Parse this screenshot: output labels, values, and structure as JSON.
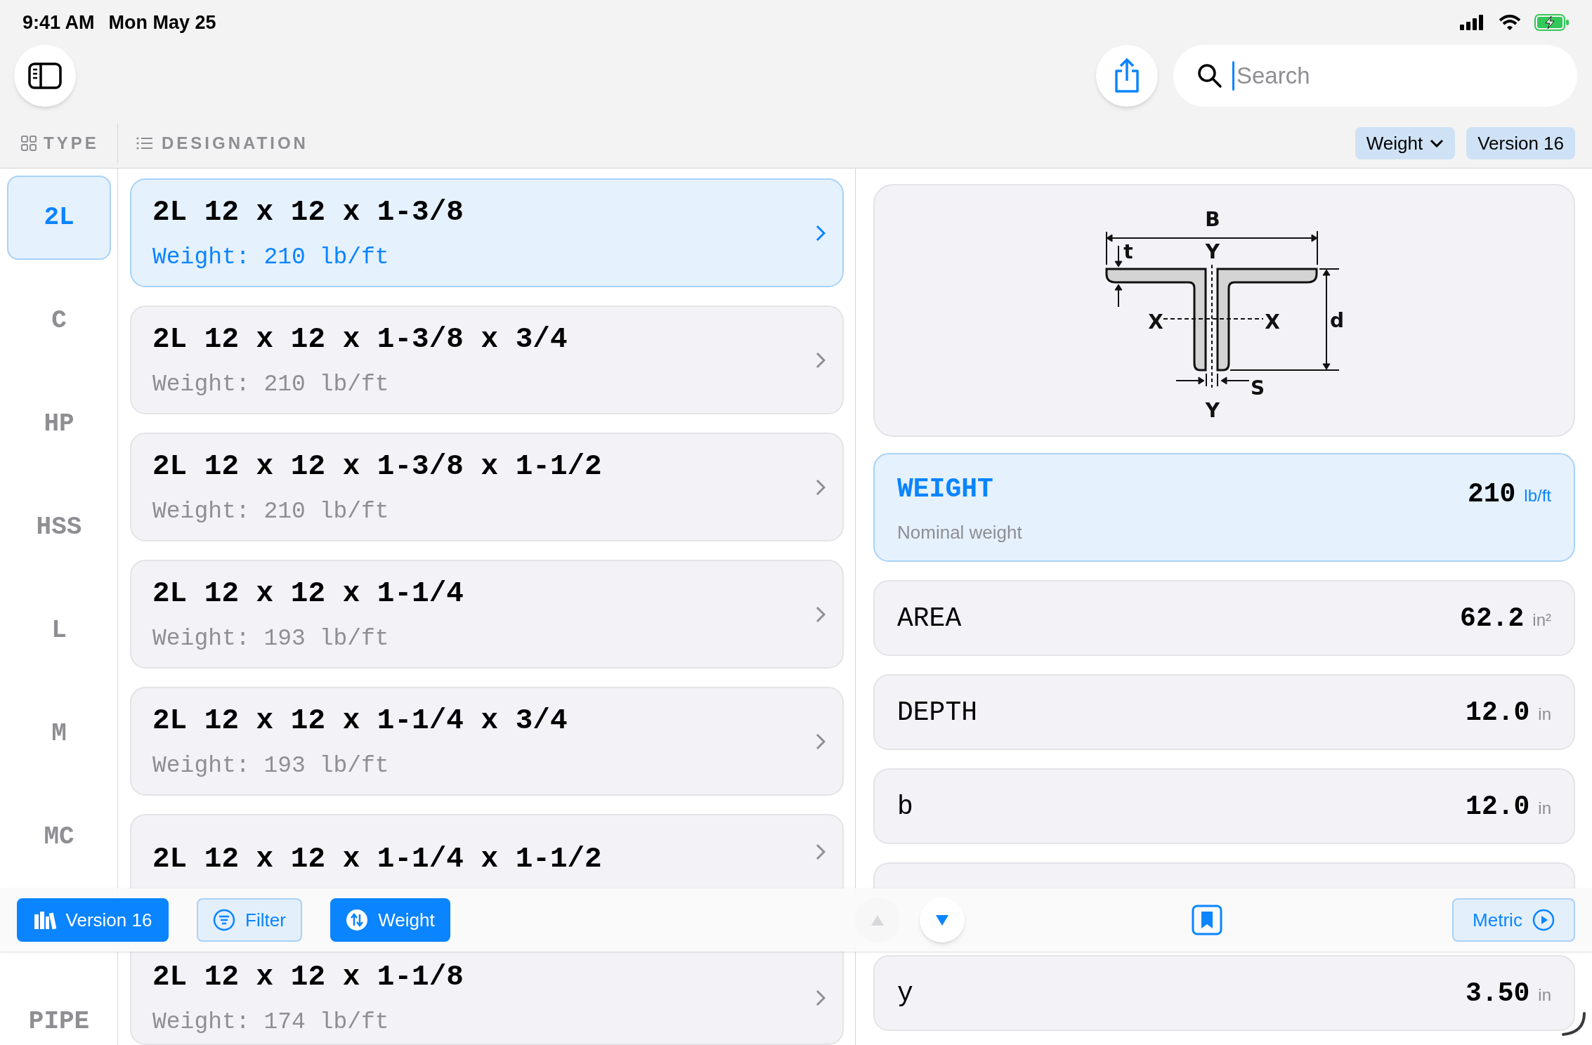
{
  "status_bar": {
    "time": "9:41 AM",
    "date": "Mon May 25"
  },
  "search": {
    "placeholder": "Search"
  },
  "headers": {
    "type": "TYPE",
    "designation": "DESIGNATION"
  },
  "chips": [
    {
      "label": "Weight",
      "kind": "dropdown"
    },
    {
      "label": "Version 16",
      "kind": "plain"
    }
  ],
  "types": [
    {
      "label": "2L",
      "selected": true
    },
    {
      "label": "C",
      "selected": false
    },
    {
      "label": "HP",
      "selected": false
    },
    {
      "label": "HSS",
      "selected": false
    },
    {
      "label": "L",
      "selected": false
    },
    {
      "label": "M",
      "selected": false
    },
    {
      "label": "MC",
      "selected": false
    },
    {
      "label": "PIPE",
      "selected": false
    }
  ],
  "sections": [
    {
      "title": "2L 12 x 12 x 1-3/8",
      "subtitle": "Weight: 210 lb/ft",
      "selected": true
    },
    {
      "title": "2L 12 x 12 x 1-3/8 x 3/4",
      "subtitle": "Weight: 210 lb/ft",
      "selected": false
    },
    {
      "title": "2L 12 x 12 x 1-3/8 x 1-1/2",
      "subtitle": "Weight: 210 lb/ft",
      "selected": false
    },
    {
      "title": "2L 12 x 12 x 1-1/4",
      "subtitle": "Weight: 193 lb/ft",
      "selected": false
    },
    {
      "title": "2L 12 x 12 x 1-1/4 x 3/4",
      "subtitle": "Weight: 193 lb/ft",
      "selected": false
    },
    {
      "title": "2L 12 x 12 x 1-1/4 x 1-1/2",
      "selected": false
    },
    {
      "title": "2L 12 x 12 x 1-1/8",
      "subtitle": "Weight: 174 lb/ft",
      "selected": false
    }
  ],
  "diagram": {
    "labels": [
      "B",
      "Y",
      "t",
      "X",
      "X",
      "d",
      "S",
      "Y"
    ]
  },
  "properties": [
    {
      "kind": "measure",
      "name": "WEIGHT",
      "description": "Nominal weight",
      "value": "210",
      "unit": "lb/ft",
      "selected": true
    },
    {
      "kind": "measure",
      "name": "AREA",
      "value": "62.2",
      "unit": "in²",
      "selected": false
    },
    {
      "kind": "measure",
      "name": "DEPTH",
      "value": "12.0",
      "unit": "in",
      "selected": false
    },
    {
      "kind": "measure",
      "name": "b",
      "value": "12.0",
      "unit": "in",
      "selected": false
    },
    {
      "kind": "empty",
      "selected": false
    },
    {
      "kind": "measure",
      "name": "y",
      "value": "3.50",
      "unit": "in",
      "selected": false
    }
  ],
  "bottom_bar": {
    "buttons": [
      {
        "label": "Version 16",
        "kind": "filled"
      },
      {
        "label": "Filter",
        "kind": "outline"
      },
      {
        "label": "Weight",
        "kind": "filled"
      }
    ],
    "nav": [
      {
        "kind": "up",
        "disabled": true
      },
      {
        "kind": "down",
        "disabled": false
      }
    ],
    "metric": {
      "label": "Metric"
    }
  }
}
